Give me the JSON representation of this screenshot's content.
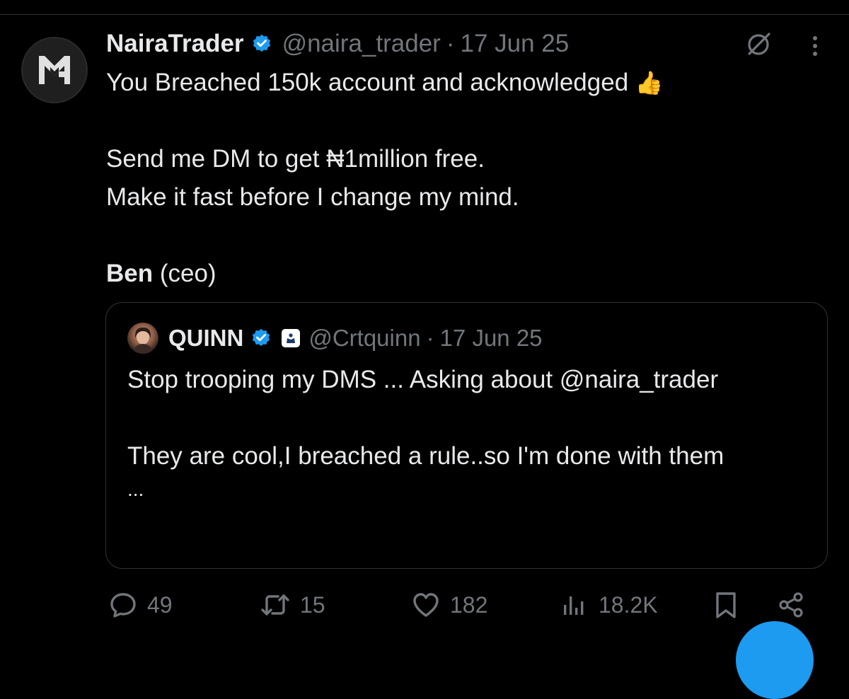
{
  "tweet": {
    "author": {
      "display_name": "NairaTrader",
      "handle": "@naira_trader",
      "verified": true,
      "avatar_icon": "nairatrader-logo-icon"
    },
    "separator": "·",
    "date": "17 Jun 25",
    "text_lines": [
      "You Breached 150k account and acknowledged",
      "",
      "Send me DM to get ₦1million free.",
      "Make it fast before I change my mind.",
      ""
    ],
    "emoji": "👍",
    "signature_name": "Ben",
    "signature_role": " (ceo)"
  },
  "quote": {
    "author": {
      "display_name": "QUINN",
      "handle": "@Crtquinn",
      "verified": true,
      "affiliate_icon": "affiliate-badge-icon"
    },
    "separator": "·",
    "date": "17 Jun 25",
    "line1": "Stop trooping my DMS ... Asking about @naira_trader",
    "line2": "They are cool,I breached a rule..so I'm done with them",
    "ellipsis": "..."
  },
  "actions": {
    "replies": "49",
    "reposts": "15",
    "likes": "182",
    "views": "18.2K"
  },
  "colors": {
    "background": "#000000",
    "text": "#e7e9ea",
    "muted": "#71767b",
    "verified_blue": "#1d9bf0",
    "border": "#2f3336"
  }
}
